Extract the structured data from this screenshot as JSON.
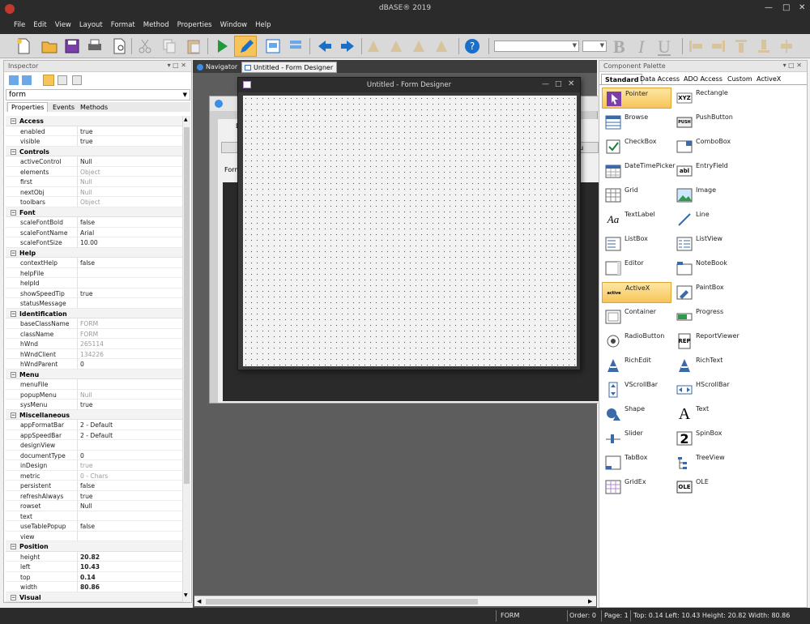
{
  "app": {
    "title": "dBASE® 2019"
  },
  "menu": [
    "File",
    "Edit",
    "View",
    "Layout",
    "Format",
    "Method",
    "Properties",
    "Window",
    "Help"
  ],
  "toolbar": {
    "font_combo_value": "",
    "size_combo_value": "",
    "bold": "B",
    "italic": "I",
    "underline": "U"
  },
  "inspector": {
    "title": "Inspector",
    "object": "form",
    "tabs": [
      "Properties",
      "Events",
      "Methods"
    ],
    "rows": [
      {
        "kind": "cat",
        "name": "Access"
      },
      {
        "kind": "prop",
        "name": "enabled",
        "value": "true",
        "style": ""
      },
      {
        "kind": "prop",
        "name": "visible",
        "value": "true",
        "style": ""
      },
      {
        "kind": "cat",
        "name": "Controls"
      },
      {
        "kind": "prop",
        "name": "activeControl",
        "value": "Null",
        "style": ""
      },
      {
        "kind": "prop",
        "name": "elements",
        "value": "Object",
        "style": "gray"
      },
      {
        "kind": "prop",
        "name": "first",
        "value": "Null",
        "style": "gray"
      },
      {
        "kind": "prop",
        "name": "nextObj",
        "value": "Null",
        "style": "gray"
      },
      {
        "kind": "prop",
        "name": "toolbars",
        "value": "Object",
        "style": "gray"
      },
      {
        "kind": "cat",
        "name": "Font"
      },
      {
        "kind": "prop",
        "name": "scaleFontBold",
        "value": "false",
        "style": ""
      },
      {
        "kind": "prop",
        "name": "scaleFontName",
        "value": "Arial",
        "style": ""
      },
      {
        "kind": "prop",
        "name": "scaleFontSize",
        "value": "10.00",
        "style": ""
      },
      {
        "kind": "cat",
        "name": "Help"
      },
      {
        "kind": "prop",
        "name": "contextHelp",
        "value": "false",
        "style": ""
      },
      {
        "kind": "prop",
        "name": "helpFile",
        "value": "",
        "style": ""
      },
      {
        "kind": "prop",
        "name": "helpId",
        "value": "",
        "style": ""
      },
      {
        "kind": "prop",
        "name": "showSpeedTip",
        "value": "true",
        "style": ""
      },
      {
        "kind": "prop",
        "name": "statusMessage",
        "value": "",
        "style": ""
      },
      {
        "kind": "cat",
        "name": "Identification"
      },
      {
        "kind": "prop",
        "name": "baseClassName",
        "value": "FORM",
        "style": "gray"
      },
      {
        "kind": "prop",
        "name": "className",
        "value": "FORM",
        "style": "gray"
      },
      {
        "kind": "prop",
        "name": "hWnd",
        "value": "265114",
        "style": "gray"
      },
      {
        "kind": "prop",
        "name": "hWndClient",
        "value": "134226",
        "style": "gray"
      },
      {
        "kind": "prop",
        "name": "hWndParent",
        "value": "0",
        "style": ""
      },
      {
        "kind": "cat",
        "name": "Menu"
      },
      {
        "kind": "prop",
        "name": "menuFile",
        "value": "",
        "style": ""
      },
      {
        "kind": "prop",
        "name": "popupMenu",
        "value": "Null",
        "style": "gray"
      },
      {
        "kind": "prop",
        "name": "sysMenu",
        "value": "true",
        "style": ""
      },
      {
        "kind": "cat",
        "name": "Miscellaneous"
      },
      {
        "kind": "prop",
        "name": "appFormatBar",
        "value": "2 - Default",
        "style": ""
      },
      {
        "kind": "prop",
        "name": "appSpeedBar",
        "value": "2 - Default",
        "style": ""
      },
      {
        "kind": "prop",
        "name": "designView",
        "value": "",
        "style": ""
      },
      {
        "kind": "prop",
        "name": "documentType",
        "value": "0",
        "style": ""
      },
      {
        "kind": "prop",
        "name": "inDesign",
        "value": "true",
        "style": "gray"
      },
      {
        "kind": "prop",
        "name": "metric",
        "value": "0 - Chars",
        "style": "gray"
      },
      {
        "kind": "prop",
        "name": "persistent",
        "value": "false",
        "style": ""
      },
      {
        "kind": "prop",
        "name": "refreshAlways",
        "value": "true",
        "style": ""
      },
      {
        "kind": "prop",
        "name": "rowset",
        "value": "Null",
        "style": ""
      },
      {
        "kind": "prop",
        "name": "text",
        "value": "",
        "style": ""
      },
      {
        "kind": "prop",
        "name": "useTablePopup",
        "value": "false",
        "style": ""
      },
      {
        "kind": "prop",
        "name": "view",
        "value": "",
        "style": ""
      },
      {
        "kind": "cat",
        "name": "Position"
      },
      {
        "kind": "prop",
        "name": "height",
        "value": "20.82",
        "style": "bold"
      },
      {
        "kind": "prop",
        "name": "left",
        "value": "10.43",
        "style": "bold"
      },
      {
        "kind": "prop",
        "name": "top",
        "value": "0.14",
        "style": "bold"
      },
      {
        "kind": "prop",
        "name": "width",
        "value": "80.86",
        "style": "bold"
      },
      {
        "kind": "cat",
        "name": "Visual"
      }
    ]
  },
  "doc_tabs": [
    "Navigator",
    "Untitled - Form Designer"
  ],
  "designer": {
    "window_title": "Untitled - Form Designer",
    "back_label_1": "Form",
    "back_label_2": "L",
    "back_label_3": "du"
  },
  "palette": {
    "title": "Component Palette",
    "tabs": [
      "Standard",
      "Data Access",
      "ADO Access",
      "Custom",
      "ActiveX"
    ],
    "components": [
      {
        "name": "Pointer",
        "icon": "pointer-icon",
        "sel": true
      },
      {
        "name": "Rectangle",
        "icon": "rectangle-icon",
        "glyph": "XYZ"
      },
      {
        "name": "Browse",
        "icon": "browse-icon"
      },
      {
        "name": "PushButton",
        "icon": "pushbutton-icon",
        "glyph": "PUSH"
      },
      {
        "name": "CheckBox",
        "icon": "checkbox-icon"
      },
      {
        "name": "ComboBox",
        "icon": "combobox-icon"
      },
      {
        "name": "DateTimePicker",
        "icon": "datetimepicker-icon"
      },
      {
        "name": "EntryField",
        "icon": "entryfield-icon",
        "glyph": "abl"
      },
      {
        "name": "Grid",
        "icon": "grid-icon"
      },
      {
        "name": "Image",
        "icon": "image-icon"
      },
      {
        "name": "TextLabel",
        "icon": "textlabel-icon",
        "glyph": "Aa"
      },
      {
        "name": "Line",
        "icon": "line-icon"
      },
      {
        "name": "ListBox",
        "icon": "listbox-icon"
      },
      {
        "name": "ListView",
        "icon": "listview-icon"
      },
      {
        "name": "Editor",
        "icon": "editor-icon"
      },
      {
        "name": "NoteBook",
        "icon": "notebook-icon"
      },
      {
        "name": "ActiveX",
        "icon": "activex-icon",
        "sel": true,
        "glyph": "active"
      },
      {
        "name": "PaintBox",
        "icon": "paintbox-icon"
      },
      {
        "name": "Container",
        "icon": "container-icon"
      },
      {
        "name": "Progress",
        "icon": "progress-icon"
      },
      {
        "name": "RadioButton",
        "icon": "radiobutton-icon"
      },
      {
        "name": "ReportViewer",
        "icon": "reportviewer-icon",
        "glyph": "REP"
      },
      {
        "name": "RichEdit",
        "icon": "richedit-icon"
      },
      {
        "name": "RichText",
        "icon": "richtext-icon"
      },
      {
        "name": "VScrollBar",
        "icon": "vscrollbar-icon"
      },
      {
        "name": "HScrollBar",
        "icon": "hscrollbar-icon"
      },
      {
        "name": "Shape",
        "icon": "shape-icon"
      },
      {
        "name": "Text",
        "icon": "text-icon",
        "glyph": "A"
      },
      {
        "name": "Slider",
        "icon": "slider-icon"
      },
      {
        "name": "SpinBox",
        "icon": "spinbox-icon",
        "glyph": "2"
      },
      {
        "name": "TabBox",
        "icon": "tabbox-icon"
      },
      {
        "name": "TreeView",
        "icon": "treeview-icon"
      },
      {
        "name": "GridEx",
        "icon": "gridex-icon"
      },
      {
        "name": "OLE",
        "icon": "ole-icon",
        "glyph": "OLE"
      }
    ]
  },
  "status": {
    "mode": "FORM",
    "order": "Order: 0",
    "page": "Page: 1",
    "position": "Top: 0.14 Left: 10.43 Height: 20.82 Width: 80.86"
  }
}
